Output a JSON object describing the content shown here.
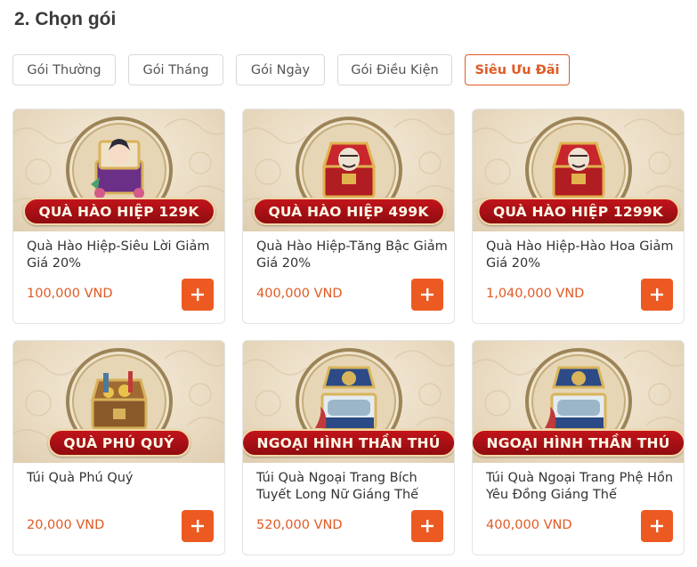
{
  "section": {
    "title": "2. Chọn gói"
  },
  "tabs": [
    {
      "label": "Gói Thường",
      "active": false
    },
    {
      "label": "Gói Tháng",
      "active": false
    },
    {
      "label": "Gói Ngày",
      "active": false
    },
    {
      "label": "Gói Điều Kiện",
      "active": false
    },
    {
      "label": "Siêu Ưu Đãi",
      "active": true
    }
  ],
  "colors": {
    "accent": "#ec5a22",
    "ribbon": "#b0121a",
    "price": "#e05a24"
  },
  "packages": [
    {
      "banner": "QUÀ HÀO HIỆP 129K",
      "name": "Quà Hào Hiệp-Siêu Lời Giảm Giá 20%",
      "price": "100,000 VND",
      "art": "hero-chest-icon"
    },
    {
      "banner": "QUÀ HÀO HIỆP 499K",
      "name": "Quà Hào Hiệp-Tăng Bậc Giảm Giá 20%",
      "price": "400,000 VND",
      "art": "red-chest-icon"
    },
    {
      "banner": "QUÀ HÀO HIỆP 1299K",
      "name": "Quà Hào Hiệp-Hào Hoa Giảm Giá 20%",
      "price": "1,040,000 VND",
      "art": "red-chest-icon"
    },
    {
      "banner": "QUÀ PHÚ QUÝ",
      "name": "Túi Quà Phú Quý",
      "price": "20,000 VND",
      "art": "treasure-chest-icon"
    },
    {
      "banner": "NGOẠI HÌNH THẦN THÚ",
      "name": "Túi Quà Ngoại Trang Bích Tuyết Long Nữ Giáng Thế",
      "price": "520,000 VND",
      "art": "blue-chest-icon"
    },
    {
      "banner": "NGOẠI HÌNH THẦN THÚ",
      "name": "Túi Quà Ngoại Trang Phệ Hồn Yêu Đồng Giáng Thế",
      "price": "400,000 VND",
      "art": "blue-chest-icon"
    }
  ]
}
